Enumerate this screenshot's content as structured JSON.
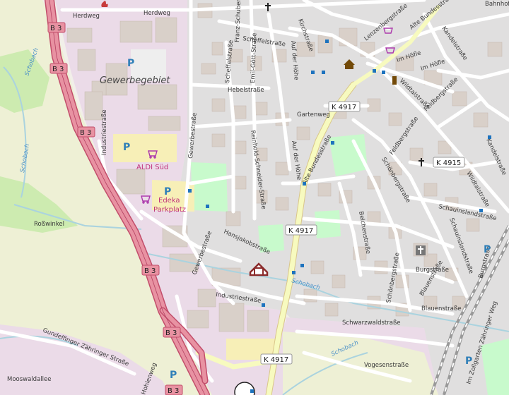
{
  "district": "Gewerbegebiet",
  "streets": {
    "herdweg_w": "Herdweg",
    "herdweg_e": "Herdweg",
    "scheffelstrasse": "Scheffelstraße",
    "franz_schubert": "Franz-Schubert-Straße",
    "kirchstrasse": "Kirchstraße",
    "emil_gott": "Emil-Gött-Straße",
    "scheffelstrasse2": "Scheffelstraße",
    "auf_der_hoehe_n": "Auf der Höhe",
    "auf_der_hoehe_s": "Auf der Höhe",
    "hebelstrasse": "Hebelstraße",
    "gartenweg": "Gartenweg",
    "industriestrasse_n": "Industriestraße",
    "industriestrasse_s": "Industriestraße",
    "gewerbestrasse_n": "Gewerbestraße",
    "gewerbestrasse_s": "Gewerbestraße",
    "reinhold_schneider": "Reinhold-Schneider-Straße",
    "alte_bundesstrasse_w": "Alte Bundesstraße",
    "alte_bundesstrasse_e": "Alte Bundesstraße",
    "hansjakobstrasse": "Hansjakobstraße",
    "rosswinkel": "Roßwinkel",
    "lenzenbergstrasse": "Lenzenbergstraße",
    "kandelstrasse_n": "Kandelstraße",
    "kandelstrasse_s": "Kandelstraße",
    "im_hofle_1": "Im Höfle",
    "im_hofle_2": "Im Höfle",
    "wildtalstrasse_n": "Wildtalstraße",
    "wildtalstrasse_s": "Wildtalstraße",
    "feldbergstrasse_n": "Feldbergstraße",
    "feldbergstrasse_s": "Feldbergstraße",
    "schoenbergstrasse_n": "Schönbergstraße",
    "schoenbergstrasse_s": "Schönbergstraße",
    "schauinslandstrasse_1": "Schauinslandstraße",
    "schauinslandstrasse_2": "Schauinslandstraße",
    "belchenstrasse": "Belchenstraße",
    "burgstrasse": "Burgstraße",
    "blauenstrasse_1": "Blauenstraße",
    "blauenstrasse_2": "Blauenstraße",
    "schwarzwaldstrasse": "Schwarzwaldstraße",
    "vogesenstrasse": "Vogesenstraße",
    "zaehringer_weg": "Im Zollgarten Zähringer Weg",
    "mooswaldallee": "Mooswaldallee",
    "hohlenweg": "Hohlenweg",
    "zaehringer_strasse": "Gundelfinger Zähringer Straße",
    "bahnhofstrasse": "Bahnhofstraße",
    "burgstrasse_e": "Burgstraße"
  },
  "water": {
    "schobach_1": "Schobach",
    "schobach_2": "Schobach",
    "schobach_3": "Schobach",
    "schobach_4": "Schobach"
  },
  "pois": {
    "aldi": "ALDI Süd",
    "edeka_1": "Edeka",
    "edeka_2": "Parkplatz"
  },
  "parking_letter": "P",
  "road_refs": {
    "b3": "B 3",
    "k4917": "K 4917",
    "k4915": "K 4915"
  },
  "icons": [
    "parking-icon",
    "shop-icon",
    "church-icon",
    "bus-stop-icon",
    "castle-icon",
    "monument-icon",
    "fire-station-icon",
    "museum-icon"
  ],
  "colors": {
    "background": "#f2efe9",
    "residential": "#e0dfdf",
    "industrial": "#ebdbe8",
    "farmland": "#eef0d5",
    "motorway": "#e892a2",
    "primary": "#fcd6a4",
    "secondary": "#f7fabf",
    "building": "#d9d0c9",
    "water": "#aad3df",
    "park": "#c8facc"
  }
}
